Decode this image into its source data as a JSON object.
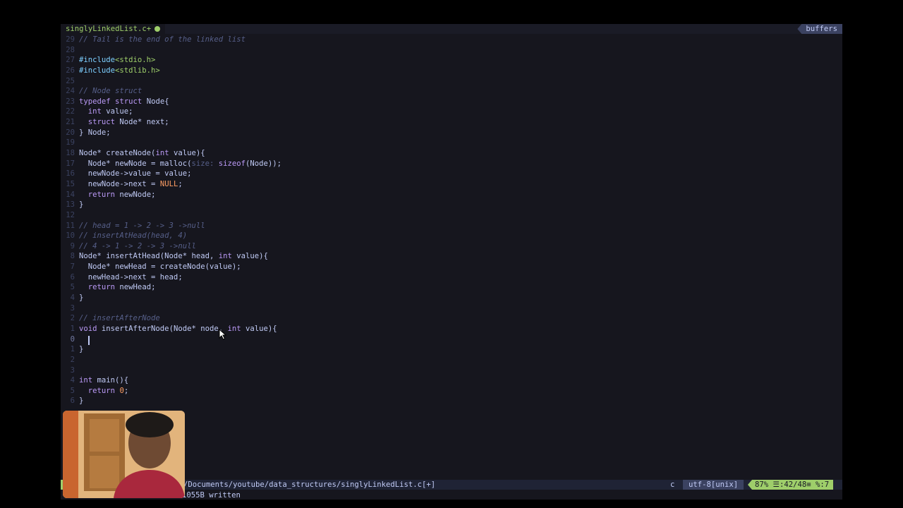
{
  "tab": {
    "filename": "singlyLinkedList.c+",
    "buffers_label": "buffers"
  },
  "code_lines": [
    {
      "n": "29",
      "html": "<span class='cmt'>// Tail is the end of the linked list</span>"
    },
    {
      "n": "28",
      "html": ""
    },
    {
      "n": "27",
      "html": "<span class='pre'>#include</span><span style='color:#9ece6a'>&lt;stdio.h&gt;</span>"
    },
    {
      "n": "26",
      "html": "<span class='pre'>#include</span><span style='color:#9ece6a'>&lt;stdlib.h&gt;</span>"
    },
    {
      "n": "25",
      "html": ""
    },
    {
      "n": "24",
      "html": "<span class='cmt'>// Node struct</span>"
    },
    {
      "n": "23",
      "html": "<span class='kw'>typedef</span> <span class='kw'>struct</span> Node{"
    },
    {
      "n": "22",
      "html": "  <span class='kw'>int</span> value;"
    },
    {
      "n": "21",
      "html": "  <span class='kw'>struct</span> Node* next;"
    },
    {
      "n": "20",
      "html": "} Node;"
    },
    {
      "n": "19",
      "html": ""
    },
    {
      "n": "18",
      "html": "Node* createNode(<span class='kw'>int</span> value){"
    },
    {
      "n": "17",
      "html": "  Node* newNode = malloc(<span class='cmt' style='font-style:normal'>size:</span> <span class='kw'>sizeof</span>(Node));"
    },
    {
      "n": "16",
      "html": "  newNode-&gt;value = value;"
    },
    {
      "n": "15",
      "html": "  newNode-&gt;next = <span class='num'>NULL</span>;"
    },
    {
      "n": "14",
      "html": "  <span class='kw'>return</span> newNode;"
    },
    {
      "n": "13",
      "html": "}"
    },
    {
      "n": "12",
      "html": ""
    },
    {
      "n": "11",
      "html": "<span class='cmt'>// head = 1 -&gt; 2 -&gt; 3 -&gt;null</span>"
    },
    {
      "n": "10",
      "html": "<span class='cmt'>// insertAtHead(head, 4)</span>"
    },
    {
      "n": "9",
      "html": "<span class='cmt'>// 4 -&gt; 1 -&gt; 2 -&gt; 3 -&gt;null</span>"
    },
    {
      "n": "8",
      "html": "Node* insertAtHead(Node* head, <span class='kw'>int</span> value){"
    },
    {
      "n": "7",
      "html": "  Node* newHead = createNode(value);"
    },
    {
      "n": "6",
      "html": "  newHead-&gt;next = head;"
    },
    {
      "n": "5",
      "html": "  <span class='kw'>return</span> newHead;"
    },
    {
      "n": "4",
      "html": "}"
    },
    {
      "n": "3",
      "html": ""
    },
    {
      "n": "2",
      "html": "<span class='cmt'>// insertAfterNode</span>"
    },
    {
      "n": "1",
      "html": "<span class='kw'>void</span> insertAfterNode(Node* node, <span class='kw'>int</span> value){"
    },
    {
      "n": "0",
      "html": ""
    },
    {
      "n": "1",
      "html": "}"
    },
    {
      "n": "2",
      "html": ""
    },
    {
      "n": "3",
      "html": ""
    },
    {
      "n": "4",
      "html": "<span class='kw'>int</span> main(){"
    },
    {
      "n": "5",
      "html": "  <span class='kw'>return</span> <span class='num'>0</span>;"
    },
    {
      "n": "6",
      "html": "}"
    }
  ],
  "status": {
    "filepath": "/Documents/youtube/data_structures/singlyLinkedList.c[+]",
    "filetype": "c",
    "encoding": "utf-8[unix]",
    "progress": "87% ☰:42/48≡ %:7"
  },
  "message": "1055B written",
  "colors": {
    "accent": "#9ece6a",
    "background": "#16161e",
    "keyword": "#bb9af7",
    "comment": "#565f89"
  },
  "icons": {
    "modified_dot": "dot-icon",
    "pointer": "mouse-pointer-icon"
  }
}
